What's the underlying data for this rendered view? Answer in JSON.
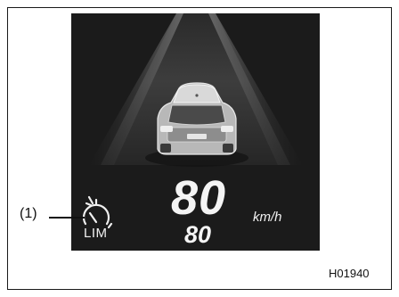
{
  "display": {
    "speed_value": "80",
    "speed_limit_value": "80",
    "speed_unit": "km/h",
    "limiter_label": "LIM",
    "limiter_icon": "speedometer-limiter-icon"
  },
  "annotations": {
    "callout_label": "(1)",
    "figure_code": "H01940"
  },
  "colors": {
    "display_background": "#1b1b1b",
    "lane_highlight": "#6a6a6a",
    "text": "#f4f4f4"
  }
}
